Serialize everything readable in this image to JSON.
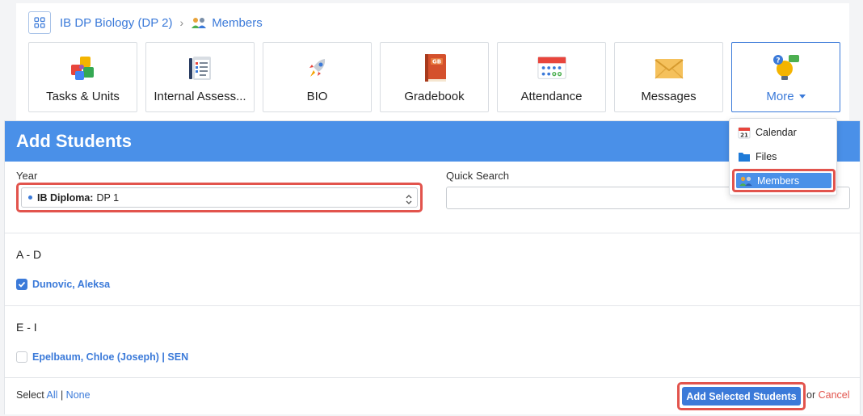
{
  "breadcrumb": {
    "course": "IB DP Biology (DP 2)",
    "separator": "›",
    "current": "Members"
  },
  "tiles": [
    {
      "label": "Tasks & Units",
      "icon": "puzzle-icon"
    },
    {
      "label": "Internal Assess...",
      "icon": "clipboard-icon"
    },
    {
      "label": "BIO",
      "icon": "rocket-icon"
    },
    {
      "label": "Gradebook",
      "icon": "gradebook-icon"
    },
    {
      "label": "Attendance",
      "icon": "attendance-calendar-icon"
    },
    {
      "label": "Messages",
      "icon": "envelope-icon"
    },
    {
      "label": "More",
      "icon": "lightbulb-chat-icon"
    }
  ],
  "more_menu": [
    {
      "label": "Calendar",
      "icon": "calendar-icon",
      "badge": "21"
    },
    {
      "label": "Files",
      "icon": "folder-icon"
    },
    {
      "label": "Members",
      "icon": "members-icon",
      "active": true
    }
  ],
  "panel": {
    "title": "Add Students",
    "year_label": "Year",
    "year_value_bold": "IB Diploma:",
    "year_value": "DP 1",
    "quick_search_label": "Quick Search",
    "quick_search_value": ""
  },
  "groups": [
    {
      "title": "A - D",
      "students": [
        {
          "name": "Dunovic, Aleksa",
          "checked": true
        }
      ]
    },
    {
      "title": "E - I",
      "students": [
        {
          "name": "Epelbaum, Chloe (Joseph) | SEN",
          "checked": false
        }
      ]
    }
  ],
  "footer": {
    "select_label": "Select",
    "all": "All",
    "sep": "|",
    "none": "None",
    "add_button": "Add Selected Students",
    "or": "or",
    "cancel": "Cancel"
  },
  "colors": {
    "accent": "#3b7ad9",
    "header": "#4a90e8",
    "highlight": "#e2544d"
  }
}
